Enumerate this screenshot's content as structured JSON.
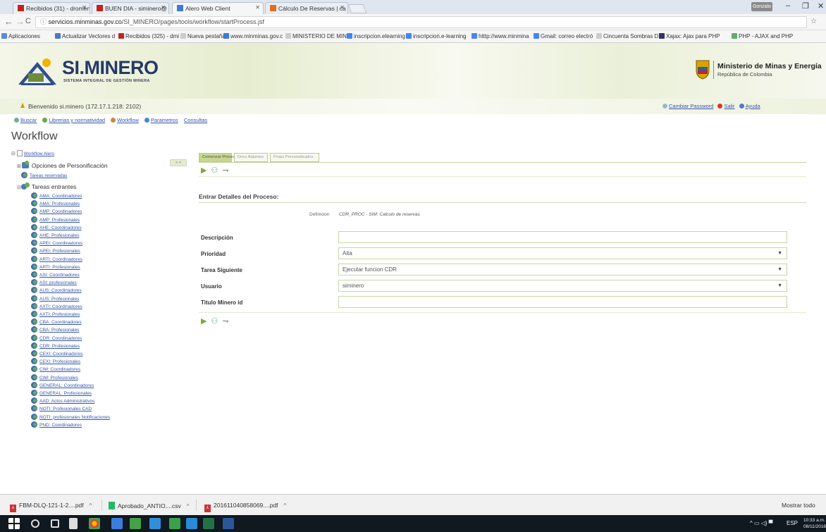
{
  "browser_tabs": [
    {
      "title": "Recibidos (31) - dromen",
      "color": "#c5221f"
    },
    {
      "title": "BUEN DIA - siminero@",
      "color": "#c5221f"
    },
    {
      "title": "Alero Web Client",
      "color": "#3a7bd5"
    },
    {
      "title": "Cálculo De Reservas | ca",
      "color": "#e07020"
    }
  ],
  "user_badge": "Gonzalo",
  "url": {
    "prefix": "servicios.minminas.gov.co",
    "path": "/SI_MINERO/pages/tools/workflow/startProcess.jsf"
  },
  "bookmarks": [
    "Aplicaciones",
    "Actualizar Vectores d",
    "Recibidos (325) - dmi",
    "Nueva pestaña",
    "www.minminas.gov.c",
    "MINISTERIO DE MINA",
    "inscripcion.elearning",
    "inscripcion.e-learning",
    "htttp://www.minmina",
    "Gmail: correo electró",
    "Cincuenta Sombras D",
    "Xajax: Ajax para PHP",
    "PHP - AJAX and PHP"
  ],
  "brand": {
    "name": "SI.MINERO",
    "subtitle": "SISTEMA INTEGRAL DE GESTIÓN MINERA",
    "ministry": "Ministerio de Minas y Energía",
    "country": "República de Colombia"
  },
  "welcome": "Bienvenido si.minero (172.17.1.218: 2102)",
  "user_links": {
    "change_password": "Cambiar Password",
    "logout": "Salir",
    "help": "Ayuda"
  },
  "top_menu": [
    "Buscar",
    "Librerias y normatividad",
    "Workflow",
    "Parametros",
    "Consultas"
  ],
  "page_title": "Workflow",
  "tree": {
    "root": "Workflow Alero",
    "options": "Opciones de Personificación",
    "reserved": "Tareas reservadas",
    "incoming": "Tareas entrantes",
    "items": [
      "AMA: Coordinadores",
      "AMA: Profesionales",
      "AMP: Coordinadores",
      "AMP: Profesionales",
      "AHE: Coordinadores",
      "AHE: Profesionales",
      "APEI: Coordinadores",
      "APEI: Profesionales",
      "ARTI: Coordinadores",
      "ARTI: Profesionales",
      "ASI: Coordinadores",
      "ASI: profesionales",
      "AUS: Coordinadores",
      "AUS: Profesionales",
      "AXTI: Coordinadores",
      "AXTI: Profesionales",
      "CBA: Coordinadores",
      "CBA: Profesionales",
      "CDR: Coordinadores",
      "CDR: Profesionales",
      "CEXI: Coordinadores",
      "CEXI: Profesionales",
      "CIM: Coordinadores",
      "CIM: Profesionales",
      "GENERAL: Coordinadores",
      "GENERAL: Profesionales",
      "AAD: Actos Administrativos",
      "NOTI: Profesionales CAD",
      "NOTI: profesionales Notificaciones",
      "PND: Coordinadores"
    ]
  },
  "collapse_label": "« «",
  "process_tabs": [
    "Comenzar Proceso",
    "Docs Adjuntos",
    "Props Personalizados"
  ],
  "section_title": "Entrar Detalles del Proceso:",
  "definition": {
    "label": "Definicion",
    "value": "CDR_PROC - SIM: Calculo de reservas"
  },
  "fields": [
    {
      "label": "Descripción",
      "value": "",
      "type": "text"
    },
    {
      "label": "Prioridad",
      "value": "Alta",
      "type": "select"
    },
    {
      "label": "Tarea Siguiente",
      "value": "Ejecutar funcion CDR",
      "type": "select"
    },
    {
      "label": "Usuario",
      "value": "siminero",
      "type": "select"
    },
    {
      "label": "Titulo Minero id",
      "value": "",
      "type": "text"
    }
  ],
  "downloads": [
    "FBM-DLQ-121-1-2....pdf",
    "Aprobado_ANTIO....csv",
    "201611040858069....pdf"
  ],
  "show_all": "Mostrar todo",
  "tray": {
    "lang": "ESP",
    "time": "10:33 a.m.",
    "date": "08/11/2016"
  }
}
